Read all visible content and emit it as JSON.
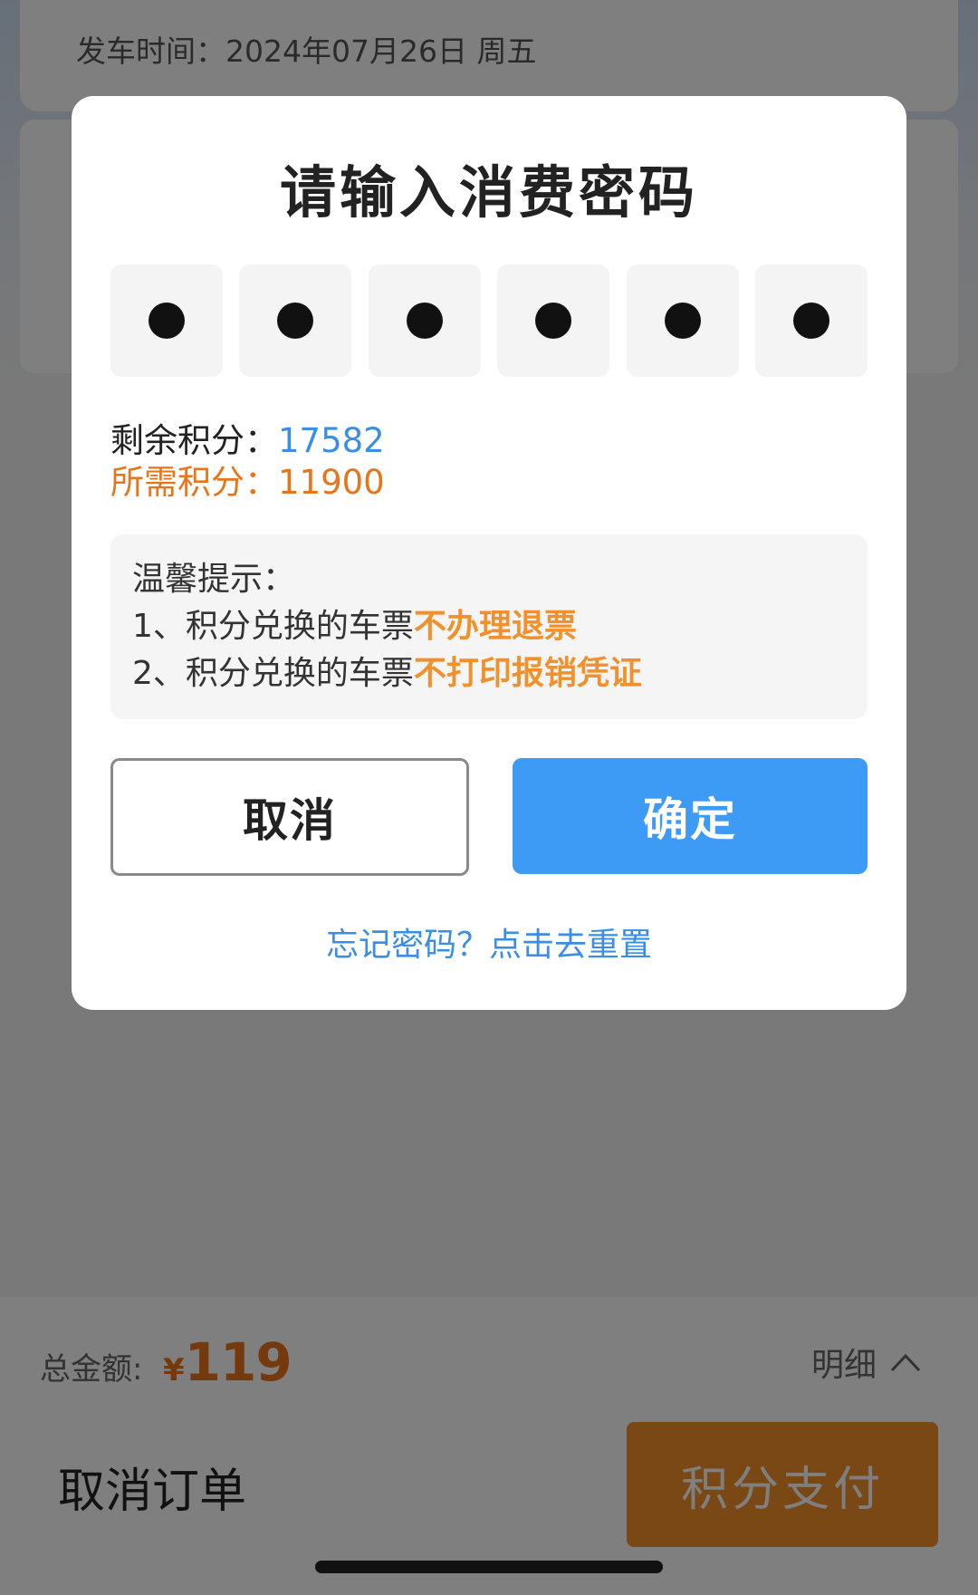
{
  "background": {
    "departure_time": "发车时间：2024年07月26日 周五",
    "total_label": "总金额:",
    "total_currency": "¥",
    "total_amount": "119",
    "detail_toggle": "明细",
    "cancel_order": "取消订单",
    "pay_button": "积分支付"
  },
  "modal": {
    "title": "请输入消费密码",
    "pin_length": 6,
    "remaining_label": "剩余积分：",
    "remaining_value": "17582",
    "required_label": "所需积分：",
    "required_value": "11900",
    "tips_title": "温馨提示：",
    "tip1_prefix": "1、积分兑换的车票",
    "tip1_highlight": "不办理退票",
    "tip2_prefix": "2、积分兑换的车票",
    "tip2_highlight": "不打印报销凭证",
    "cancel_button": "取消",
    "confirm_button": "确定",
    "forgot_link": "忘记密码？点击去重置"
  },
  "colors": {
    "accent_blue": "#3d9bf5",
    "accent_orange": "#f2912b"
  },
  "icons": {
    "detail_toggle": "chevron-up-icon"
  }
}
